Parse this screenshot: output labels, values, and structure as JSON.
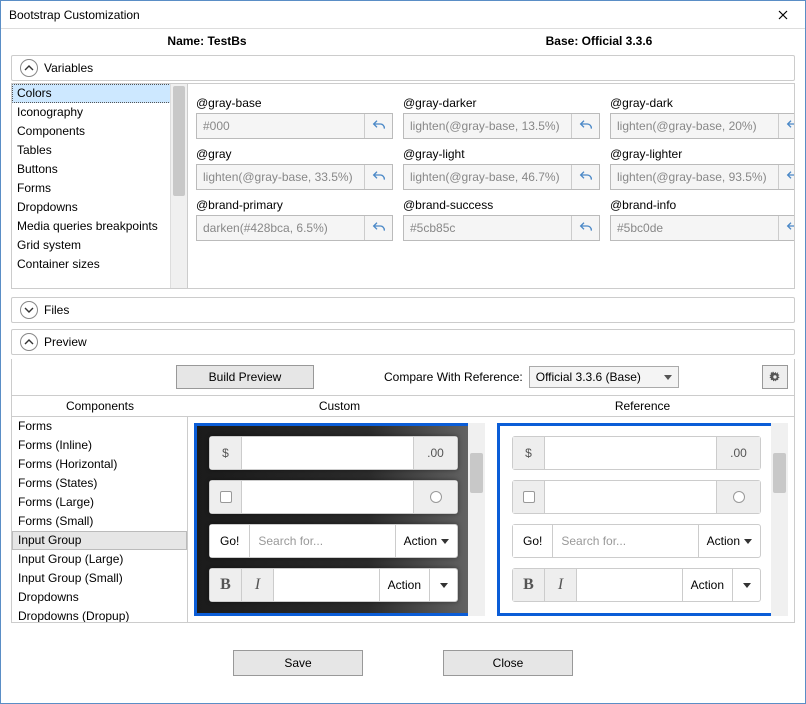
{
  "window": {
    "title": "Bootstrap Customization"
  },
  "header": {
    "name_label": "Name:",
    "name_value": "TestBs",
    "base_label": "Base:",
    "base_value": "Official 3.3.6"
  },
  "sections": {
    "variables": "Variables",
    "files": "Files",
    "preview": "Preview"
  },
  "categories": {
    "selected": "Colors",
    "items": [
      "Colors",
      "Iconography",
      "Components",
      "Tables",
      "Buttons",
      "Forms",
      "Dropdowns",
      "Media queries breakpoints",
      "Grid system",
      "Container sizes"
    ]
  },
  "vars": [
    {
      "name": "@gray-base",
      "value": "#000"
    },
    {
      "name": "@gray-darker",
      "value": "lighten(@gray-base, 13.5%)"
    },
    {
      "name": "@gray-dark",
      "value": "lighten(@gray-base, 20%)"
    },
    {
      "name": "@gray",
      "value": "lighten(@gray-base, 33.5%)"
    },
    {
      "name": "@gray-light",
      "value": "lighten(@gray-base, 46.7%)"
    },
    {
      "name": "@gray-lighter",
      "value": "lighten(@gray-base, 93.5%)"
    },
    {
      "name": "@brand-primary",
      "value": "darken(#428bca, 6.5%)"
    },
    {
      "name": "@brand-success",
      "value": "#5cb85c"
    },
    {
      "name": "@brand-info",
      "value": "#5bc0de"
    }
  ],
  "preview_toolbar": {
    "build": "Build Preview",
    "compare_label": "Compare With Reference:",
    "compare_value": "Official 3.3.6 (Base)"
  },
  "preview_headers": {
    "components": "Components",
    "custom": "Custom",
    "reference": "Reference"
  },
  "components": {
    "selected": "Input Group",
    "items": [
      "Forms",
      "Forms (Inline)",
      "Forms (Horizontal)",
      "Forms (States)",
      "Forms (Large)",
      "Forms (Small)",
      "Input Group",
      "Input Group (Large)",
      "Input Group (Small)",
      "Dropdowns",
      "Dropdowns (Dropup)"
    ]
  },
  "widgets": {
    "dollar": "$",
    "cents": ".00",
    "go": "Go!",
    "search_placeholder": "Search for...",
    "action": "Action",
    "bold": "B",
    "italic": "I"
  },
  "footer": {
    "save": "Save",
    "close": "Close"
  }
}
